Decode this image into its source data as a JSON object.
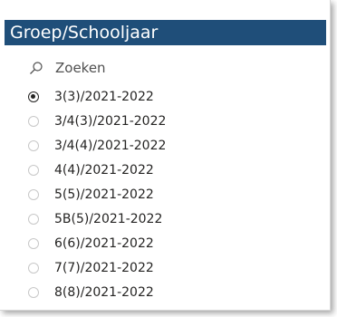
{
  "slicer": {
    "title": "Groep/Schooljaar",
    "search_placeholder": "Zoeken",
    "items": [
      {
        "label": "3(3)/2021-2022",
        "selected": true
      },
      {
        "label": "3/4(3)/2021-2022",
        "selected": false
      },
      {
        "label": "3/4(4)/2021-2022",
        "selected": false
      },
      {
        "label": "4(4)/2021-2022",
        "selected": false
      },
      {
        "label": "5(5)/2021-2022",
        "selected": false
      },
      {
        "label": "5B(5)/2021-2022",
        "selected": false
      },
      {
        "label": "6(6)/2021-2022",
        "selected": false
      },
      {
        "label": "7(7)/2021-2022",
        "selected": false
      },
      {
        "label": "8(8)/2021-2022",
        "selected": false
      }
    ]
  },
  "colors": {
    "header_bg": "#1f4e79",
    "header_text": "#ffffff",
    "item_text": "#252423"
  }
}
